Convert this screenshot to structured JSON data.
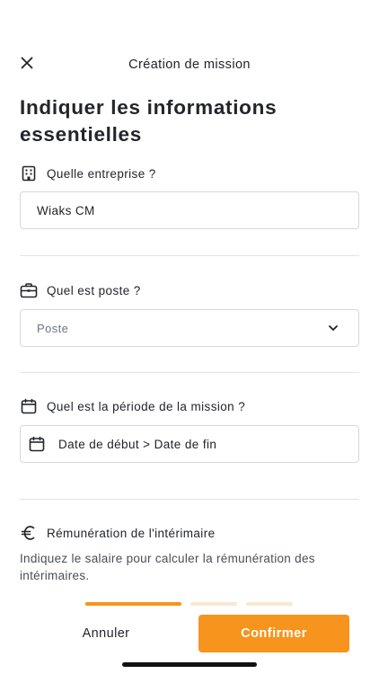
{
  "header": {
    "title": "Création de mission",
    "close_icon": "close-icon"
  },
  "page_title": "Indiquer les informations essentielles",
  "company": {
    "label": "Quelle entreprise ?",
    "icon": "building-icon",
    "value": "Wiaks CM"
  },
  "position": {
    "label": "Quel est poste ?",
    "icon": "briefcase-icon",
    "placeholder": "Poste",
    "dropdown_icon": "chevron-down-icon"
  },
  "period": {
    "label": "Quel est la période de la mission ?",
    "icon": "calendar-icon",
    "value": "Date de début > Date de fin"
  },
  "remuneration": {
    "label": "Rémunération de l'intérimaire",
    "icon": "euro-icon",
    "description": "Indiquez le salaire pour calculer la rémunération des intérimaires."
  },
  "progress": {
    "steps": 3,
    "current_step": 1,
    "active_color": "#f7941d",
    "inactive_color": "#fbe8d2"
  },
  "footer": {
    "cancel_label": "Annuler",
    "confirm_label": "Confirmer",
    "accent_color": "#f7941d"
  }
}
